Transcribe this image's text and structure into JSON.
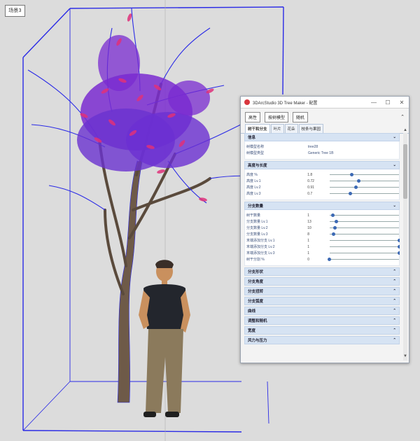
{
  "scene": {
    "label": "场景3"
  },
  "window": {
    "title": "3DArcStudio 3D Tree Maker - 配置",
    "buttons": [
      "—",
      "☐",
      "✕"
    ]
  },
  "toolbar": {
    "buttons": [
      "高性",
      "按树模型",
      "随机"
    ]
  },
  "tabs": [
    "树干和分支",
    "叶片",
    "花朵",
    "枝条与果园"
  ],
  "sections": [
    {
      "title": "信息",
      "collapsed": false,
      "rows": [
        {
          "label": "树模型名称",
          "text": "tree28"
        },
        {
          "label": "树模型类型",
          "text": "Generic Tree 1B"
        }
      ]
    },
    {
      "title": "高度与长度",
      "collapsed": false,
      "rows": [
        {
          "label": "高度 %",
          "value": "1.8",
          "level": 0.32
        },
        {
          "label": "高度 Lv.1",
          "value": "0.72",
          "level": 0.42
        },
        {
          "label": "高度 Lv.2",
          "value": "0.91",
          "level": 0.38
        },
        {
          "label": "高度 Lv.3",
          "value": "0.7",
          "level": 0.3
        }
      ]
    },
    {
      "title": "分支数量",
      "collapsed": false,
      "rows": [
        {
          "label": "树干数量",
          "value": "1",
          "level": 0.05
        },
        {
          "label": "分支数量 Lv.1",
          "value": "13",
          "level": 0.1
        },
        {
          "label": "分支数量 Lv.2",
          "value": "10",
          "level": 0.08
        },
        {
          "label": "分支数量 Lv.3",
          "value": "8",
          "level": 0.06
        },
        {
          "label": "末端添加分支 Lv.1",
          "value": "1",
          "level": 1.0
        },
        {
          "label": "末端添加分支 Lv.2",
          "value": "1",
          "level": 1.0
        },
        {
          "label": "末端添加分支 Lv.3",
          "value": "1",
          "level": 1.0
        },
        {
          "label": "树干分割 %",
          "value": "0",
          "level": 0.0
        }
      ]
    },
    {
      "title": "分支形状",
      "collapsed": true,
      "rows": []
    },
    {
      "title": "分支角度",
      "collapsed": true,
      "rows": []
    },
    {
      "title": "分支扭转",
      "collapsed": true,
      "rows": []
    },
    {
      "title": "分支弧度",
      "collapsed": true,
      "rows": []
    },
    {
      "title": "曲线",
      "collapsed": true,
      "rows": []
    },
    {
      "title": "调整和随机",
      "collapsed": true,
      "rows": []
    },
    {
      "title": "宽度",
      "collapsed": true,
      "rows": []
    },
    {
      "title": "风力与压力",
      "collapsed": true,
      "rows": []
    }
  ],
  "colors": {
    "wireframe": "#2a2ae6",
    "leaves": "#e0317a",
    "trunk": "#6e5a48"
  }
}
